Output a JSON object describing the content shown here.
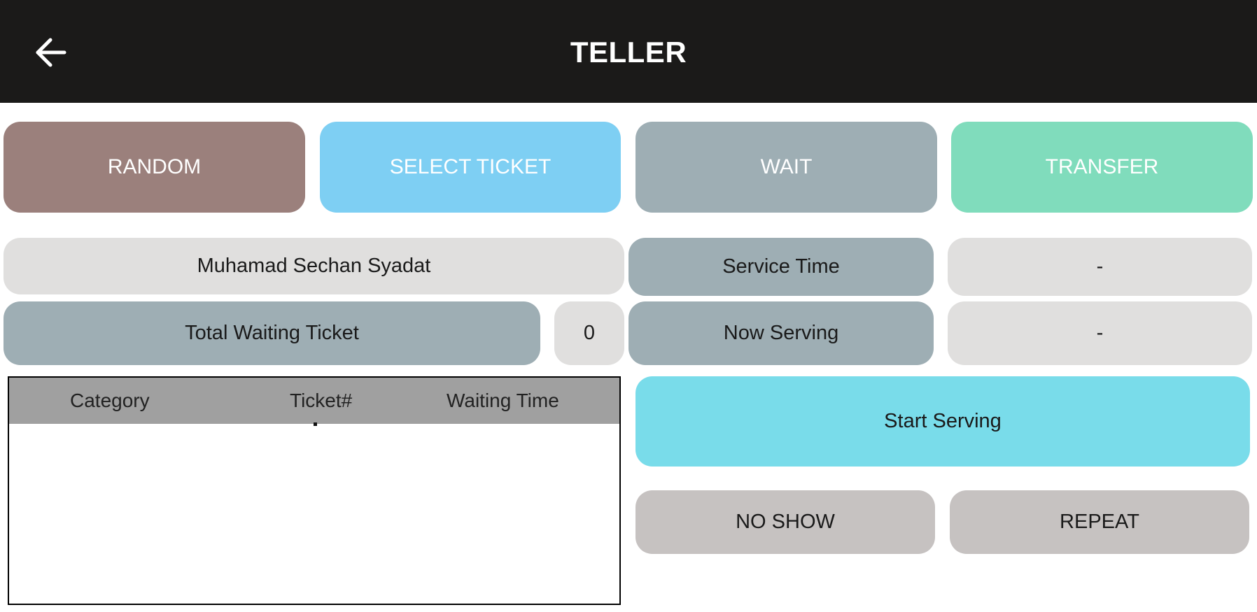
{
  "header": {
    "back_icon": "arrow-left-icon",
    "title": "TELLER"
  },
  "actions": {
    "random": "RANDOM",
    "select_ticket": "SELECT TICKET",
    "wait": "WAIT",
    "transfer": "TRANSFER"
  },
  "info": {
    "teller_name": "Muhamad Sechan Syadat",
    "service_time_label": "Service Time",
    "service_time_value": "-",
    "total_waiting_label": "Total Waiting Ticket",
    "total_waiting_value": "0",
    "now_serving_label": "Now Serving",
    "now_serving_value": "-"
  },
  "queue_table": {
    "columns": [
      "Category",
      "Ticket#",
      "Waiting Time"
    ],
    "rows": []
  },
  "controls": {
    "start_serving": "Start Serving",
    "no_show": "NO SHOW",
    "repeat": "REPEAT"
  },
  "colors": {
    "topbar": "#1b1a19",
    "random": "#9b807c",
    "select_ticket": "#7ecff3",
    "wait": "#9eaeb4",
    "transfer": "#80dcbc",
    "label_slate": "#9eaeb4",
    "value_light": "#e0dfde",
    "start_serving": "#79dcea",
    "neutral_button": "#c6c2c1"
  }
}
